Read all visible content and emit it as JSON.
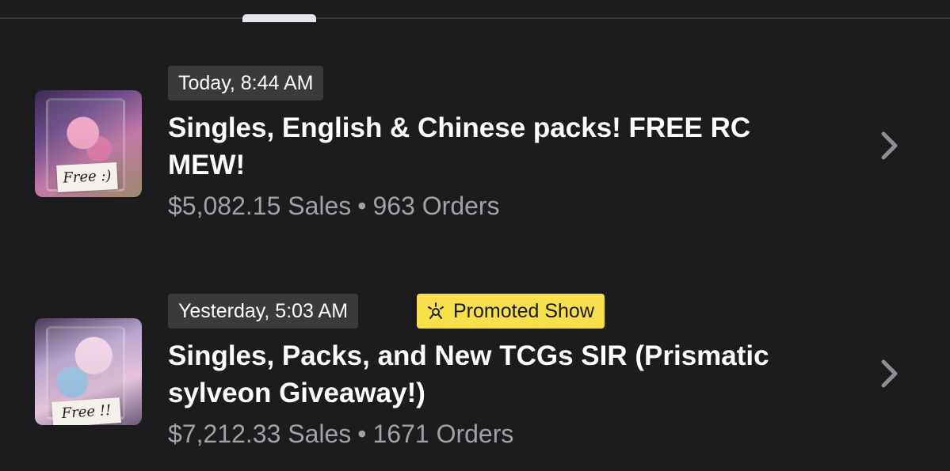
{
  "shows": [
    {
      "time": "Today, 8:44 AM",
      "promoted": "",
      "title": "Singles, English & Chinese packs! FREE RC MEW!",
      "sales": "$5,082.15 Sales",
      "separator": "•",
      "orders": "963 Orders",
      "thumbnail_note": "Free :)",
      "thumbnail_icon": "pokemon-card-image"
    },
    {
      "time": "Yesterday, 5:03 AM",
      "promoted": "Promoted Show",
      "title": "Singles, Packs, and New TCGs SIR (Prismatic sylveon Giveaway!)",
      "sales": "$7,212.33 Sales",
      "separator": "•",
      "orders": "1671 Orders",
      "thumbnail_note": "Free !!",
      "thumbnail_icon": "pokemon-card-image"
    }
  ],
  "colors": {
    "background": "#1c1c1e",
    "time_badge": "#3a3a3c",
    "promoted_badge": "#f7e04a",
    "secondary_text": "#a1a1a6",
    "chevron": "#8e8e93"
  },
  "icons": {
    "chevron": "chevron-right-icon",
    "promoted": "promoted-spark-icon"
  }
}
